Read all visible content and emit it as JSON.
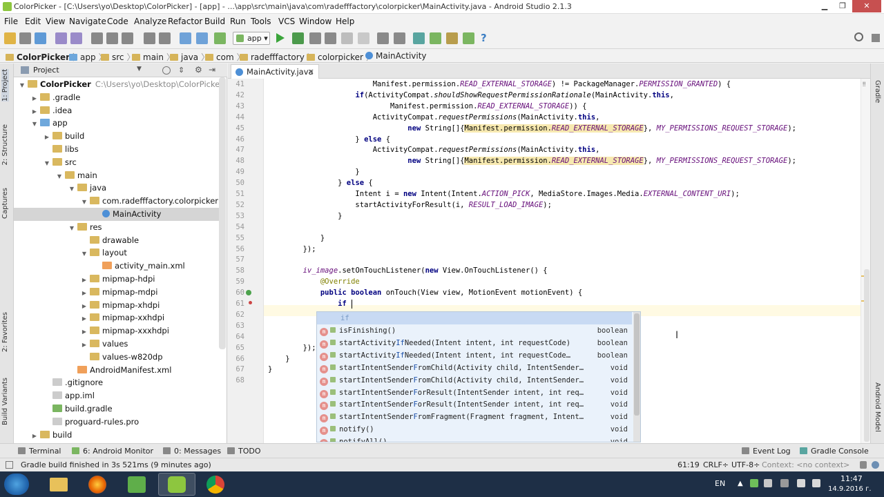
{
  "window": {
    "title": "ColorPicker - [C:\\Users\\yo\\Desktop\\ColorPicker] - [app] - ...\\app\\src\\main\\java\\com\\radefffactory\\colorpicker\\MainActivity.java - Android Studio 2.1.3",
    "minimize": "▁",
    "maximize": "❐",
    "close": "✕"
  },
  "menubar": [
    "File",
    "Edit",
    "View",
    "Navigate",
    "Code",
    "Analyze",
    "Refactor",
    "Build",
    "Run",
    "Tools",
    "VCS",
    "Window",
    "Help"
  ],
  "toolbar": {
    "run_config": "app",
    "help": "?"
  },
  "breadcrumb": [
    "ColorPicker",
    "app",
    "src",
    "main",
    "java",
    "com",
    "radefffactory",
    "colorpicker",
    "MainActivity"
  ],
  "left_tabs": [
    "1: Project",
    "2: Structure",
    "Captures",
    "2: Favorites",
    "Build Variants"
  ],
  "right_tabs": [
    "Gradle",
    "Android Model"
  ],
  "project": {
    "header": "Project",
    "tree": [
      {
        "label": "ColorPicker",
        "path": "C:\\Users\\yo\\Desktop\\ColorPicker",
        "depth": 0,
        "icon": "folder",
        "arrow": "▼"
      },
      {
        "label": ".gradle",
        "depth": 1,
        "icon": "folder",
        "arrow": "▶"
      },
      {
        "label": ".idea",
        "depth": 1,
        "icon": "folder",
        "arrow": "▶"
      },
      {
        "label": "app",
        "depth": 1,
        "icon": "module",
        "arrow": "▼"
      },
      {
        "label": "build",
        "depth": 2,
        "icon": "folder",
        "arrow": "▶"
      },
      {
        "label": "libs",
        "depth": 2,
        "icon": "folder",
        "arrow": ""
      },
      {
        "label": "src",
        "depth": 2,
        "icon": "folder",
        "arrow": "▼"
      },
      {
        "label": "main",
        "depth": 3,
        "icon": "folder",
        "arrow": "▼"
      },
      {
        "label": "java",
        "depth": 4,
        "icon": "folder",
        "arrow": "▼"
      },
      {
        "label": "com.radefffactory.colorpicker",
        "depth": 5,
        "icon": "folder",
        "arrow": "▼"
      },
      {
        "label": "MainActivity",
        "depth": 6,
        "icon": "class",
        "arrow": "",
        "selected": true
      },
      {
        "label": "res",
        "depth": 4,
        "icon": "folder",
        "arrow": "▼"
      },
      {
        "label": "drawable",
        "depth": 5,
        "icon": "folder",
        "arrow": ""
      },
      {
        "label": "layout",
        "depth": 5,
        "icon": "folder",
        "arrow": "▼"
      },
      {
        "label": "activity_main.xml",
        "depth": 6,
        "icon": "xml",
        "arrow": ""
      },
      {
        "label": "mipmap-hdpi",
        "depth": 5,
        "icon": "folder",
        "arrow": "▶"
      },
      {
        "label": "mipmap-mdpi",
        "depth": 5,
        "icon": "folder",
        "arrow": "▶"
      },
      {
        "label": "mipmap-xhdpi",
        "depth": 5,
        "icon": "folder",
        "arrow": "▶"
      },
      {
        "label": "mipmap-xxhdpi",
        "depth": 5,
        "icon": "folder",
        "arrow": "▶"
      },
      {
        "label": "mipmap-xxxhdpi",
        "depth": 5,
        "icon": "folder",
        "arrow": "▶"
      },
      {
        "label": "values",
        "depth": 5,
        "icon": "folder",
        "arrow": "▶"
      },
      {
        "label": "values-w820dp",
        "depth": 5,
        "icon": "folder",
        "arrow": ""
      },
      {
        "label": "AndroidManifest.xml",
        "depth": 4,
        "icon": "xml",
        "arrow": ""
      },
      {
        "label": ".gitignore",
        "depth": 2,
        "icon": "text",
        "arrow": ""
      },
      {
        "label": "app.iml",
        "depth": 2,
        "icon": "text",
        "arrow": ""
      },
      {
        "label": "build.gradle",
        "depth": 2,
        "icon": "gradle",
        "arrow": ""
      },
      {
        "label": "proguard-rules.pro",
        "depth": 2,
        "icon": "text",
        "arrow": ""
      },
      {
        "label": "build",
        "depth": 1,
        "icon": "folder",
        "arrow": "▶"
      }
    ]
  },
  "editor": {
    "tab_label": "MainActivity.java",
    "tab_close": "✕",
    "line_numbers": [
      "41",
      "42",
      "43",
      "44",
      "45",
      "46",
      "47",
      "48",
      "49",
      "50",
      "51",
      "52",
      "53",
      "54",
      "55",
      "56",
      "57",
      "58",
      "59",
      "60",
      "61",
      "62",
      "63",
      "64",
      "65",
      "66",
      "67",
      "68"
    ],
    "code": [
      [
        {
          "t": "                        Manifest.permission."
        },
        {
          "t": "READ_EXTERNAL_STORAGE",
          "c": "fld"
        },
        {
          "t": ") != PackageManager."
        },
        {
          "t": "PERMISSION_GRANTED",
          "c": "fld"
        },
        {
          "t": ") {"
        }
      ],
      [
        {
          "t": "                    "
        },
        {
          "t": "if",
          "c": "kw"
        },
        {
          "t": "(ActivityCompat."
        },
        {
          "t": "shouldShowRequestPermissionRationale",
          "c": "mth"
        },
        {
          "t": "(MainActivity."
        },
        {
          "t": "this",
          "c": "kw"
        },
        {
          "t": ","
        }
      ],
      [
        {
          "t": "                            Manifest.permission."
        },
        {
          "t": "READ_EXTERNAL_STORAGE",
          "c": "fld"
        },
        {
          "t": ")) {"
        }
      ],
      [
        {
          "t": "                        ActivityCompat."
        },
        {
          "t": "requestPermissions",
          "c": "mth"
        },
        {
          "t": "(MainActivity."
        },
        {
          "t": "this",
          "c": "kw"
        },
        {
          "t": ","
        }
      ],
      [
        {
          "t": "                                "
        },
        {
          "t": "new",
          "c": "kw"
        },
        {
          "t": " String[]{"
        },
        {
          "t": "Manifest.permission.",
          "c": "hl"
        },
        {
          "t": "READ_EXTERNAL_STORAGE",
          "c": "fld hl"
        },
        {
          "t": "}, "
        },
        {
          "t": "MY_PERMISSIONS_REQUEST_STORAGE",
          "c": "fld"
        },
        {
          "t": ");"
        }
      ],
      [
        {
          "t": "                    } "
        },
        {
          "t": "else",
          "c": "kw"
        },
        {
          "t": " {"
        }
      ],
      [
        {
          "t": "                        ActivityCompat."
        },
        {
          "t": "requestPermissions",
          "c": "mth"
        },
        {
          "t": "(MainActivity."
        },
        {
          "t": "this",
          "c": "kw"
        },
        {
          "t": ","
        }
      ],
      [
        {
          "t": "                                "
        },
        {
          "t": "new",
          "c": "kw"
        },
        {
          "t": " String[]{"
        },
        {
          "t": "Manifest.permission.",
          "c": "hl"
        },
        {
          "t": "READ_EXTERNAL_STORAGE",
          "c": "fld hl"
        },
        {
          "t": "}, "
        },
        {
          "t": "MY_PERMISSIONS_REQUEST_STORAGE",
          "c": "fld"
        },
        {
          "t": ");"
        }
      ],
      [
        {
          "t": "                    }"
        }
      ],
      [
        {
          "t": "                } "
        },
        {
          "t": "else",
          "c": "kw"
        },
        {
          "t": " {"
        }
      ],
      [
        {
          "t": "                    Intent i = "
        },
        {
          "t": "new",
          "c": "kw"
        },
        {
          "t": " Intent(Intent."
        },
        {
          "t": "ACTION_PICK",
          "c": "fld"
        },
        {
          "t": ", MediaStore.Images.Media."
        },
        {
          "t": "EXTERNAL_CONTENT_URI",
          "c": "fld"
        },
        {
          "t": ");"
        }
      ],
      [
        {
          "t": "                    startActivityForResult(i, "
        },
        {
          "t": "RESULT_LOAD_IMAGE",
          "c": "fld"
        },
        {
          "t": ");"
        }
      ],
      [
        {
          "t": "                }"
        }
      ],
      [
        {
          "t": ""
        }
      ],
      [
        {
          "t": "            }"
        }
      ],
      [
        {
          "t": "        });"
        }
      ],
      [
        {
          "t": ""
        }
      ],
      [
        {
          "t": "        "
        },
        {
          "t": "iv_image",
          "c": "fld"
        },
        {
          "t": ".setOnTouchListener("
        },
        {
          "t": "new",
          "c": "kw"
        },
        {
          "t": " View.OnTouchListener() {"
        }
      ],
      [
        {
          "t": "            "
        },
        {
          "t": "@Override",
          "c": "ann"
        }
      ],
      [
        {
          "t": "            "
        },
        {
          "t": "public boolean",
          "c": "kw"
        },
        {
          "t": " onTouch(View view, MotionEvent motionEvent) {"
        }
      ],
      [
        {
          "t": "                "
        },
        {
          "t": "if",
          "c": "kw"
        }
      ],
      [
        {
          "t": ""
        }
      ],
      [
        {
          "t": ""
        }
      ],
      [
        {
          "t": ""
        }
      ],
      [
        {
          "t": "        });"
        }
      ],
      [
        {
          "t": "    }"
        }
      ],
      [
        {
          "t": "}"
        }
      ],
      [
        {
          "t": ""
        }
      ]
    ],
    "completion": {
      "first": "if",
      "items": [
        {
          "m": "isFinishing",
          "hit": "",
          "rest": "()",
          "ret": "boolean"
        },
        {
          "m": "startActivity",
          "hit": "If",
          "rest": "Needed(Intent intent, int requestCode)",
          "ret": "boolean"
        },
        {
          "m": "startActivity",
          "hit": "If",
          "rest": "Needed(Intent intent, int requestCode…",
          "ret": "boolean"
        },
        {
          "m": "startIntentSender",
          "hit": "F",
          "rest": "romChild(Activity child, IntentSender…",
          "ret": "void"
        },
        {
          "m": "startIntentSender",
          "hit": "F",
          "rest": "romChild(Activity child, IntentSender…",
          "ret": "void"
        },
        {
          "m": "startIntentSender",
          "hit": "F",
          "rest": "orResult(IntentSender intent, int req…",
          "ret": "void"
        },
        {
          "m": "startIntentSender",
          "hit": "F",
          "rest": "orResult(IntentSender intent, int req…",
          "ret": "void"
        },
        {
          "m": "startIntentSender",
          "hit": "F",
          "rest": "romFragment(Fragment fragment, Intent…",
          "ret": "void"
        },
        {
          "m": "notify",
          "hit": "",
          "rest": "()",
          "ret": "void"
        },
        {
          "m": "notifyAll",
          "hit": "",
          "rest": "()",
          "ret": "void"
        }
      ]
    }
  },
  "bottom_tabs": [
    "Terminal",
    "6: Android Monitor",
    "0: Messages",
    "TODO",
    "Event Log",
    "Gradle Console"
  ],
  "status": {
    "message": "Gradle build finished in 3s 521ms (9 minutes ago)",
    "position": "61:19",
    "line_sep": "CRLF÷",
    "encoding": "UTF-8÷",
    "context": "Context: <no context>"
  },
  "taskbar": {
    "lang": "EN",
    "time": "11:47",
    "date": "14.9.2016 г."
  },
  "colors": {
    "keyword": "#000080",
    "field": "#660e7a",
    "annotation": "#808000",
    "selection": "#d5d5d5",
    "taskbar": "#1e2f46"
  }
}
